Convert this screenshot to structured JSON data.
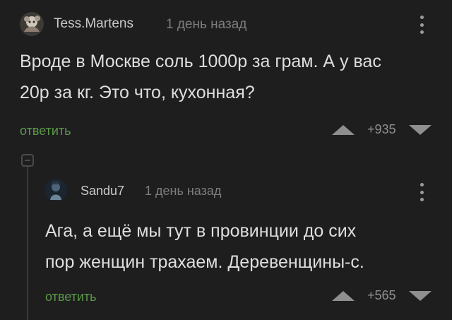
{
  "colors": {
    "background": "#1e1e1f",
    "reply_link": "#5a9a4a",
    "muted": "#7d7d7d"
  },
  "comments": [
    {
      "author": "Tess.Martens",
      "time": "1 день назад",
      "lines": [
        "Вроде в Москве соль 1000р за грам. А у вас",
        "20р за кг. Это что, кухонная?"
      ],
      "reply_label": "ответить",
      "score": "+935",
      "avatar_icon": "user-avatar-icon"
    },
    {
      "author": "Sandu7",
      "time": "1 день назад",
      "lines": [
        "Ага, а ещё мы тут в провинции до сих",
        "пор женщин трахаем. Деревенщины-с."
      ],
      "reply_label": "ответить",
      "score": "+565",
      "avatar_icon": "user-avatar-icon"
    }
  ],
  "icons": {
    "upvote": "triangle-up-icon",
    "downvote": "triangle-down-icon",
    "more": "vertical-dots-icon",
    "collapse": "collapse-thread-icon"
  }
}
